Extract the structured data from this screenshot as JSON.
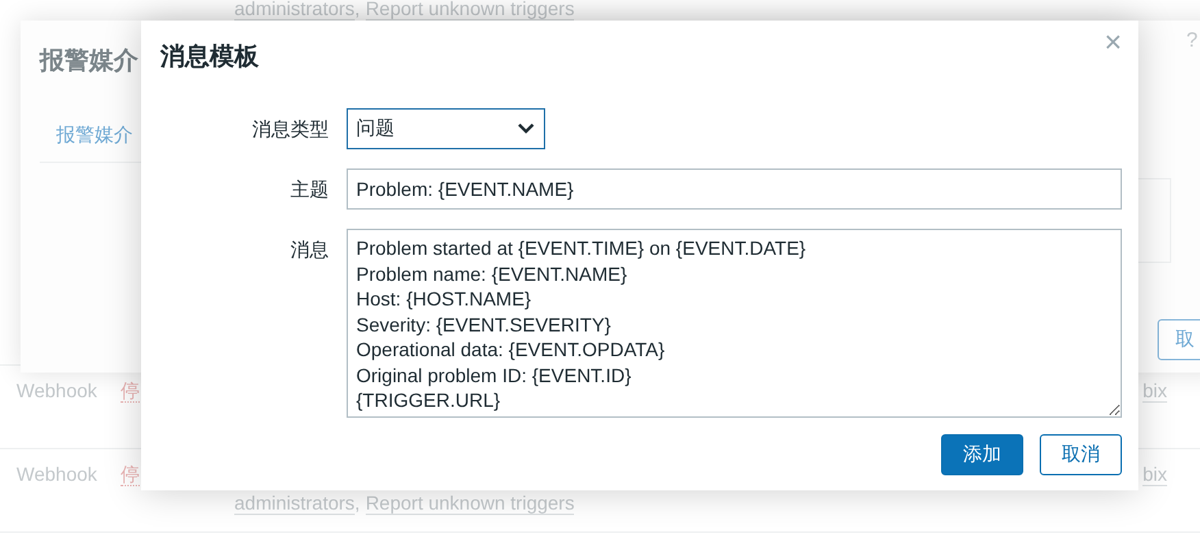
{
  "page": {
    "top_links": [
      "administrators",
      "Report unknown triggers"
    ],
    "top_separator": ",",
    "help": "?",
    "rows": [
      {
        "type": "Webhook",
        "status": "停",
        "column_3": "bix",
        "links": []
      },
      {
        "type": "Webhook",
        "status": "停",
        "column_3": "bix",
        "links": [
          "administrators",
          "Report unknown triggers"
        ]
      }
    ],
    "link_separator": ","
  },
  "media_dialog": {
    "title": "报警媒介",
    "tabs": [
      {
        "label": "报警媒介",
        "selected": true
      }
    ],
    "cancel_button": "取"
  },
  "template_dialog": {
    "title": "消息模板",
    "close": "×",
    "fields": [
      {
        "kind": "select",
        "label": "消息类型",
        "value": "问题"
      },
      {
        "kind": "text",
        "label": "主题",
        "value": "Problem: {EVENT.NAME}"
      },
      {
        "kind": "textarea",
        "label": "消息",
        "value": "Problem started at {EVENT.TIME} on {EVENT.DATE}\nProblem name: {EVENT.NAME}\nHost: {HOST.NAME}\nSeverity: {EVENT.SEVERITY}\nOperational data: {EVENT.OPDATA}\nOriginal problem ID: {EVENT.ID}\n{TRIGGER.URL}"
      }
    ],
    "buttons": [
      {
        "label": "添加",
        "primary": true
      },
      {
        "label": "取消",
        "primary": false
      }
    ]
  }
}
